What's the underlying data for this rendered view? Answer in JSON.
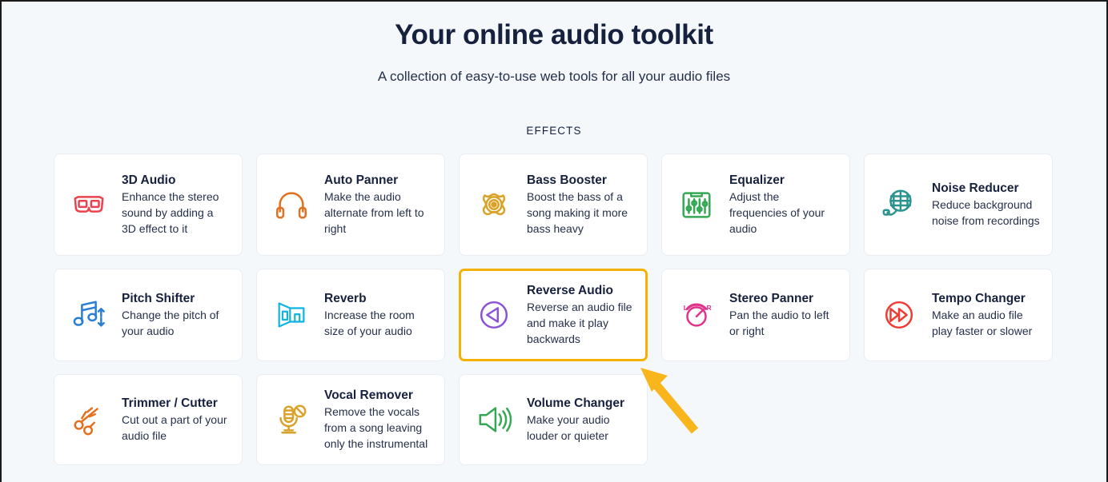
{
  "hero": {
    "title": "Your online audio toolkit",
    "subtitle": "A collection of easy-to-use web tools for all your audio files"
  },
  "section": {
    "label": "EFFECTS"
  },
  "colors": {
    "page_background": "#f4f8fb",
    "card_background": "#ffffff",
    "card_border": "#e8edf3",
    "title_text": "#16213e",
    "body_text": "#25304a",
    "selection_highlight": "#f5b100",
    "annotation_arrow": "#f9b51c"
  },
  "annotation": {
    "arrow_target": "Reverse Audio",
    "arrow_direction": "up-left"
  },
  "tools": [
    {
      "name": "3D Audio",
      "description": "Enhance the stereo sound by adding a 3D effect to it",
      "icon": "3d-glasses-icon",
      "icon_color": "#e8434e",
      "selected": false
    },
    {
      "name": "Auto Panner",
      "description": "Make the audio alternate from left to right",
      "icon": "headphones-icon",
      "icon_color": "#e4701e",
      "selected": false
    },
    {
      "name": "Bass Booster",
      "description": "Boost the bass of a song making it more bass heavy",
      "icon": "speaker-rings-icon",
      "icon_color": "#d9a329",
      "selected": false
    },
    {
      "name": "Equalizer",
      "description": "Adjust the frequencies of your audio",
      "icon": "equalizer-sliders-icon",
      "icon_color": "#34a853",
      "selected": false
    },
    {
      "name": "Noise Reducer",
      "description": "Reduce background noise from recordings",
      "icon": "grid-microphone-icon",
      "icon_color": "#2b9490",
      "selected": false
    },
    {
      "name": "Pitch Shifter",
      "description": "Change the pitch of your audio",
      "icon": "music-note-arrows-icon",
      "icon_color": "#2a7fd4",
      "selected": false
    },
    {
      "name": "Reverb",
      "description": "Increase the room size of your audio",
      "icon": "room-perspective-icon",
      "icon_color": "#0fb4e0",
      "selected": false
    },
    {
      "name": "Reverse Audio",
      "description": "Reverse an audio file and make it play backwards",
      "icon": "reverse-play-circle-icon",
      "icon_color": "#8c52d4",
      "selected": true
    },
    {
      "name": "Stereo Panner",
      "description": "Pan the audio to left or right",
      "icon": "pan-knob-icon",
      "icon_color": "#e0338a",
      "selected": false
    },
    {
      "name": "Tempo Changer",
      "description": "Make an audio file play faster or slower",
      "icon": "fast-forward-circle-icon",
      "icon_color": "#ee3b33",
      "selected": false
    },
    {
      "name": "Trimmer / Cutter",
      "description": "Cut out a part of your audio file",
      "icon": "scissors-icon",
      "icon_color": "#e4701e",
      "selected": false
    },
    {
      "name": "Vocal Remover",
      "description": "Remove the vocals from a song leaving only the instrumental",
      "icon": "microphone-blocked-icon",
      "icon_color": "#d9a329",
      "selected": false
    },
    {
      "name": "Volume Changer",
      "description": "Make your audio louder or quieter",
      "icon": "volume-waves-icon",
      "icon_color": "#34a853",
      "selected": false
    }
  ]
}
